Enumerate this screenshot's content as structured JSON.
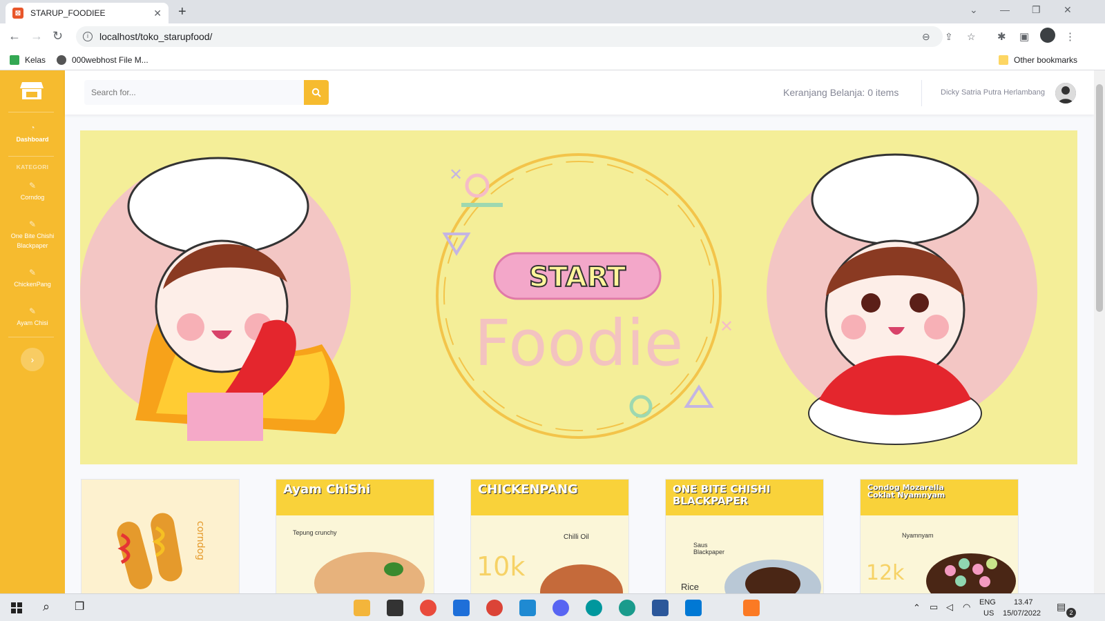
{
  "browser": {
    "tab_title": "STARUP_FOODIEE",
    "url": "localhost/toko_starupfood/",
    "bookmarks": [
      "Kelas",
      "000webhost File M..."
    ],
    "other_bookmarks": "Other bookmarks"
  },
  "sidebar": {
    "dashboard": "Dashboard",
    "category_heading": "KATEGORI",
    "items": [
      "Corndog",
      "One Bite Chishi Blackpaper",
      "ChickenPang",
      "Ayam Chisi"
    ]
  },
  "topbar": {
    "search_placeholder": "Search for...",
    "cart": "Keranjang Belanja: 0 items",
    "user_name": "Dicky Satria Putra Herlambang"
  },
  "banner": {
    "button_text": "START",
    "brand_text": "Foodie"
  },
  "cards": [
    {
      "title": "",
      "side_text": "corndog"
    },
    {
      "title": "Ayam ChiShi",
      "note": "Tepung crunchy"
    },
    {
      "title": "CHICKENPANG",
      "note": "Chilli Oil",
      "price": "10k"
    },
    {
      "title": "ONE BITE CHISHI BLACKPAPER",
      "note": "Saus Blackpaper",
      "extra": "Rice"
    },
    {
      "title": "Condog Mozarella Coklat Nyamnyam",
      "note": "Nyamnyam",
      "price": "12k"
    }
  ],
  "taskbar": {
    "lang": "ENG",
    "region": "US",
    "time": "13.47",
    "date": "15/07/2022",
    "notif_count": "2"
  }
}
